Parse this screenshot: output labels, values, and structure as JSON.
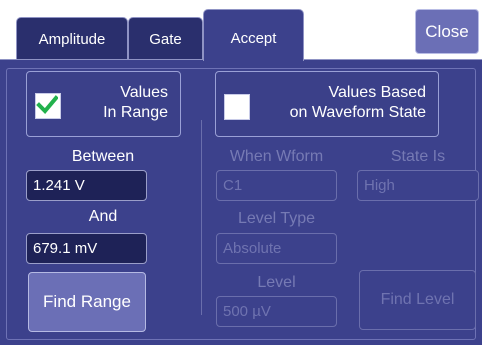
{
  "tabs": [
    {
      "label": "Amplitude",
      "active": false
    },
    {
      "label": "Gate",
      "active": false
    },
    {
      "label": "Accept",
      "active": true
    }
  ],
  "close_label": "Close",
  "values_in_range": {
    "label_line1": "Values",
    "label_line2": "In Range",
    "checked": true
  },
  "between": {
    "label": "Between",
    "value": "1.241 V"
  },
  "and": {
    "label": "And",
    "value": "679.1 mV"
  },
  "find_range_label": "Find Range",
  "values_based": {
    "label_line1": "Values Based",
    "label_line2": "on Waveform State",
    "checked": false
  },
  "when_wform": {
    "label": "When Wform",
    "value": "C1"
  },
  "state_is": {
    "label": "State Is",
    "value": "High"
  },
  "level_type": {
    "label": "Level Type",
    "value": "Absolute"
  },
  "level": {
    "label": "Level",
    "value": "500 µV"
  },
  "find_level_label": "Find Level",
  "colors": {
    "panel_bg": "#3c418c",
    "tab_bg": "#2a2f6d",
    "button_bg": "#6b6fb6",
    "field_bg": "#1e2257",
    "check_green": "#22b14c",
    "disabled_text": "#767ab4"
  }
}
